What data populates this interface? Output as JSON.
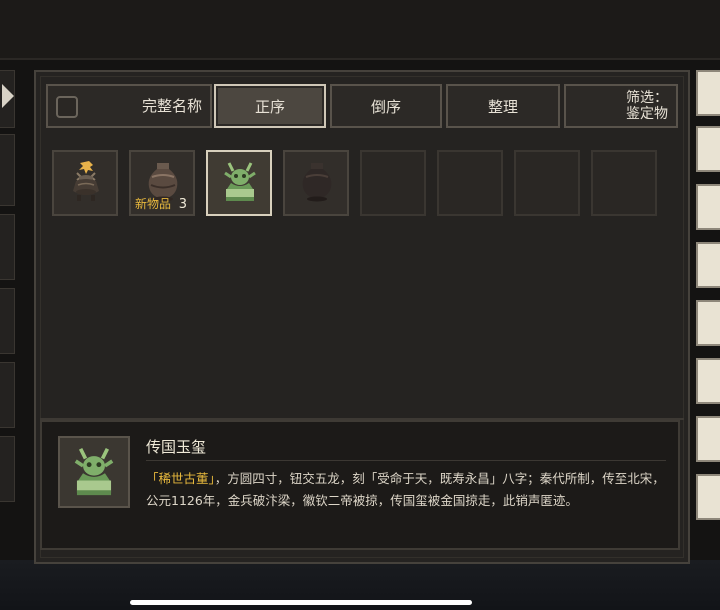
{
  "toolbar": {
    "select_all_label": "完整名称",
    "sort_asc": "正序",
    "sort_desc": "倒序",
    "arrange": "整理",
    "filter_line1": "筛选：",
    "filter_line2": "鉴定物"
  },
  "inventory": {
    "slots": [
      {
        "icon": "incense-burner-icon"
      },
      {
        "icon": "dark-vase-icon",
        "new_label": "新物品",
        "count": "3"
      },
      {
        "icon": "jade-seal-icon",
        "selected": true
      },
      {
        "icon": "dark-vase-icon"
      },
      {},
      {},
      {},
      {}
    ]
  },
  "detail": {
    "title": "传国玉玺",
    "desc_highlight": "「稀世古董」",
    "desc_rest": "，方圆四寸，钮交五龙，刻「受命于天，既寿永昌」八字；秦代所制，传至北宋，公元1126年，金兵破汴梁，徽钦二帝被掠，传国玺被金国掠走，此销声匿迹。"
  },
  "colors": {
    "accent_gold": "#e8b93d",
    "panel_bg": "#252321",
    "jade": "#7fae6a"
  }
}
